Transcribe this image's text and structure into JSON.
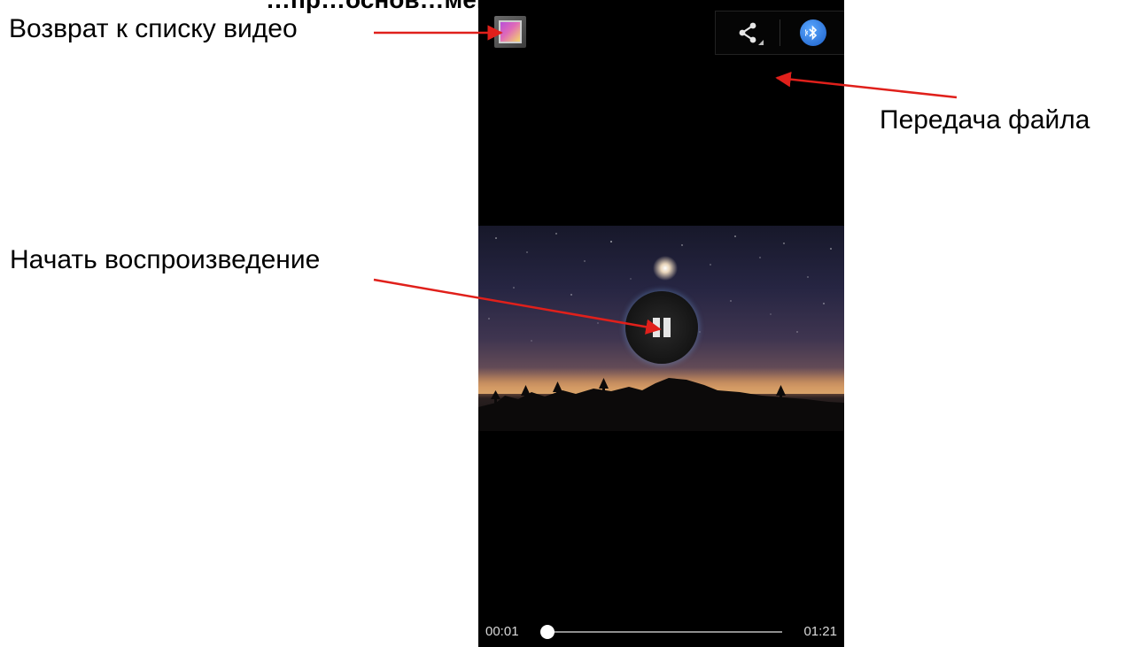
{
  "page": {
    "cut_heading": "…пр…основ…мент…управ…",
    "callouts": {
      "back": "Возврат к списку видео",
      "share": "Передача файла",
      "play": "Начать воспроизведение"
    },
    "annotation_color": "#e0201b"
  },
  "player": {
    "top_left_icon": "gallery-icon",
    "actions": [
      {
        "icon": "share-icon"
      },
      {
        "icon": "bluetooth-icon"
      }
    ],
    "center_control_icon": "pause-icon",
    "time_current": "00:01",
    "time_total": "01:21",
    "progress_fraction": 0.012
  }
}
